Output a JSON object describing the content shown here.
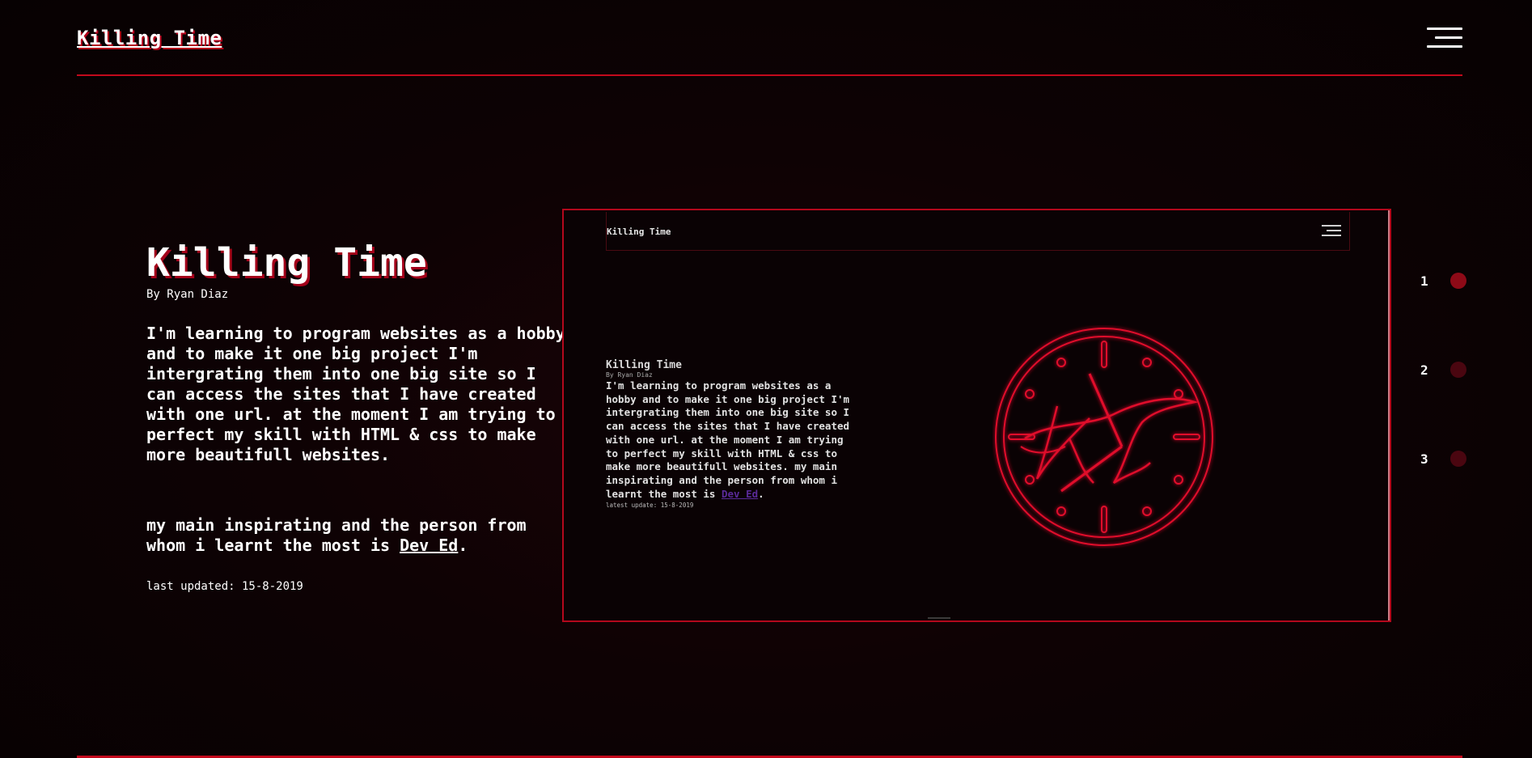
{
  "nav": {
    "logo": "Killing Time",
    "menu_icon": "hamburger-menu-icon"
  },
  "intro": {
    "title": "Killing Time",
    "author": "By Ryan Diaz",
    "description": "I'm learning to program websites as a hobby and to make it one big project I'm intergrating them into one big site so I can access the sites that I have created with one url. at the moment I am trying to perfect my skill with HTML & css to make more beautifull websites.",
    "inspire_prefix": "my main inspirating and the person from whom i learnt the most is ",
    "inspire_link": "Dev Ed",
    "inspire_suffix": ".",
    "updated": "last updated: 15-8-2019"
  },
  "preview": {
    "logo": "Killing Time",
    "title": "Killing Time",
    "author": "By Ryan Diaz",
    "description": "I'm learning to program websites as a hobby and to make it one big project I'm intergrating them into one big site so I can access the sites that I have created with one url. at the moment I am trying to perfect my skill with HTML & css to make more beautifull websites. my main inspirating and the person from whom i learnt the most is ",
    "link": "Dev Ed",
    "suffix": ".",
    "updated": "latest update: 15-8-2019",
    "clock_letters": "KT",
    "clock_icon": "kt-clock-logo-icon"
  },
  "pager": {
    "items": [
      {
        "label": "1",
        "color": "#8e0a17"
      },
      {
        "label": "2",
        "color": "#4a0610"
      },
      {
        "label": "3",
        "color": "#4a0610"
      }
    ]
  },
  "colors": {
    "accent": "#c3091c",
    "background": "#0c0203",
    "text": "#ffffff"
  }
}
